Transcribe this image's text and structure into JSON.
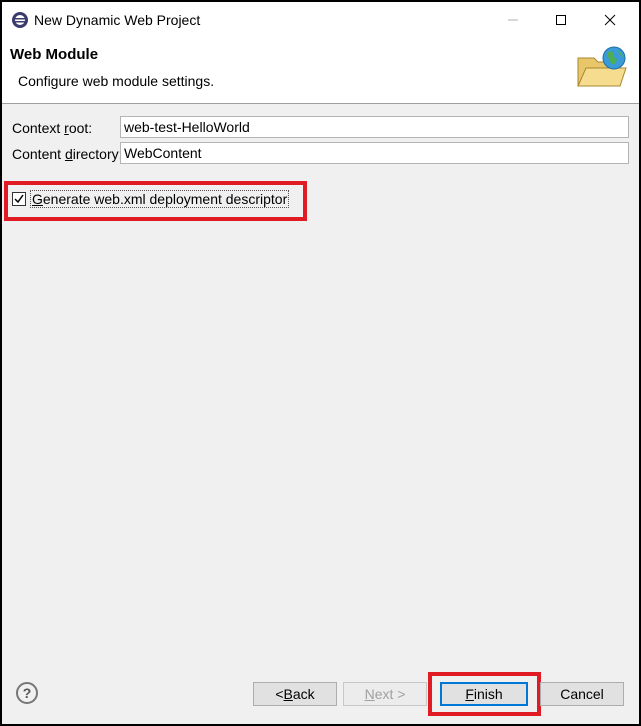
{
  "window": {
    "title": "New Dynamic Web Project"
  },
  "banner": {
    "title": "Web Module",
    "description": "Configure web module settings.",
    "icon": "folder-globe-icon"
  },
  "form": {
    "context_root": {
      "label_pre": "Context ",
      "label_mnemonic": "r",
      "label_post": "oot:",
      "value": "web-test-HelloWorld"
    },
    "content_directory": {
      "label_pre": "Content ",
      "label_mnemonic": "d",
      "label_post": "irectory:",
      "value": "WebContent"
    },
    "generate_descriptor": {
      "label_mnemonic": "G",
      "label_post": "enerate web.xml deployment descriptor",
      "checked": true
    }
  },
  "buttons": {
    "help": "?",
    "back_pre": "< ",
    "back_mnemonic": "B",
    "back_post": "ack",
    "next_mnemonic": "N",
    "next_post": "ext >",
    "finish_mnemonic": "F",
    "finish_post": "inish",
    "cancel": "Cancel"
  },
  "colors": {
    "highlight": "#e01b24",
    "focus": "#0078d7"
  }
}
